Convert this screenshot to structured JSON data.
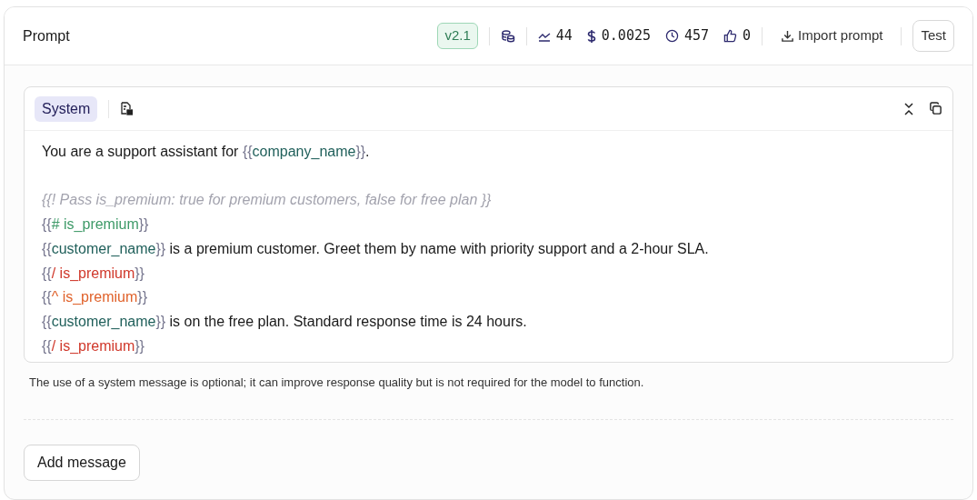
{
  "header": {
    "title": "Prompt",
    "version": "v2.1",
    "stats": [
      {
        "kind": "trend",
        "value": "44"
      },
      {
        "kind": "dollar",
        "value": "0.0025"
      },
      {
        "kind": "clock",
        "value": "457"
      },
      {
        "kind": "thumb",
        "value": "0"
      }
    ],
    "import_button": "Import prompt",
    "test_button": "Test"
  },
  "message": {
    "role": "System",
    "lines": [
      {
        "segments": [
          {
            "kind": "plain",
            "text": "You are a support assistant for "
          },
          {
            "kind": "brace",
            "text": "{{"
          },
          {
            "kind": "variable",
            "text": "company_name"
          },
          {
            "kind": "brace",
            "text": "}}"
          },
          {
            "kind": "plain",
            "text": "."
          }
        ]
      },
      {
        "kind": "blank"
      },
      {
        "segments": [
          {
            "kind": "comment",
            "text": "{{! Pass is_premium: true for premium customers, false for free plan }}"
          }
        ]
      },
      {
        "segments": [
          {
            "kind": "brace",
            "text": "{{"
          },
          {
            "kind": "open",
            "text": "# is_premium"
          },
          {
            "kind": "brace",
            "text": "}}"
          }
        ]
      },
      {
        "segments": [
          {
            "kind": "brace",
            "text": "{{"
          },
          {
            "kind": "variable",
            "text": "customer_name"
          },
          {
            "kind": "brace",
            "text": "}}"
          },
          {
            "kind": "plain",
            "text": " is a premium customer. Greet them by name with priority support and a 2-hour SLA."
          }
        ]
      },
      {
        "segments": [
          {
            "kind": "brace",
            "text": "{{"
          },
          {
            "kind": "close",
            "text": "/ is_premium"
          },
          {
            "kind": "brace",
            "text": "}}"
          }
        ]
      },
      {
        "segments": [
          {
            "kind": "brace",
            "text": "{{"
          },
          {
            "kind": "inverted",
            "text": "^ is_premium"
          },
          {
            "kind": "brace",
            "text": "}}"
          }
        ]
      },
      {
        "segments": [
          {
            "kind": "brace",
            "text": "{{"
          },
          {
            "kind": "variable",
            "text": "customer_name"
          },
          {
            "kind": "brace",
            "text": "}}"
          },
          {
            "kind": "plain",
            "text": " is on the free plan. Standard response time is 24 hours."
          }
        ]
      },
      {
        "segments": [
          {
            "kind": "brace",
            "text": "{{"
          },
          {
            "kind": "close",
            "text": "/ is_premium"
          },
          {
            "kind": "brace",
            "text": "}}"
          }
        ]
      }
    ],
    "hint": "The use of a system message is optional; it can improve response quality but is not required for the model to function."
  },
  "add_button": "Add message"
}
